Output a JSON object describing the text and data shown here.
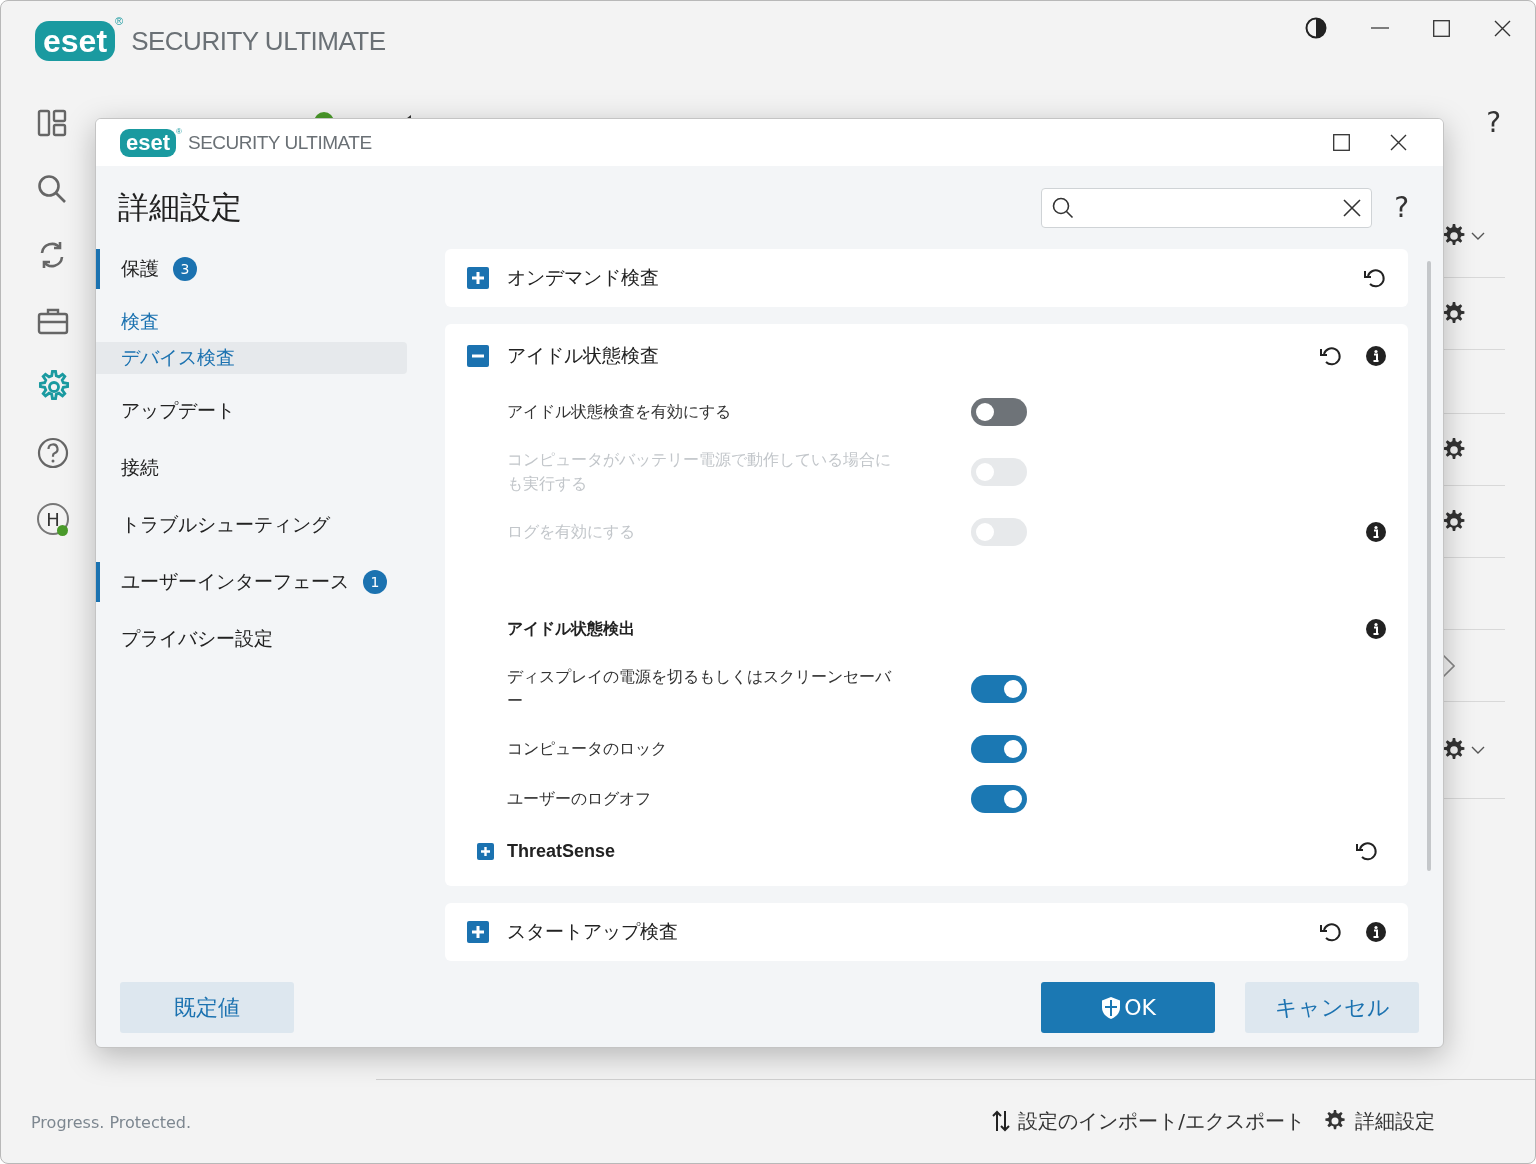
{
  "background_window": {
    "logo": {
      "brand": "eset",
      "mark": "®"
    },
    "product": "SECURITY ULTIMATE",
    "sidebar": [
      {
        "selected": false
      },
      {
        "selected": false
      },
      {
        "selected": false
      },
      {
        "selected": false
      },
      {
        "selected": true
      },
      {
        "selected": false
      },
      {
        "avatar_letter": "H",
        "selected": false
      }
    ],
    "help": "?",
    "footer": {
      "tagline": "Progress. Protected.",
      "links": [
        {
          "label": "設定のインポート/エクスポート"
        },
        {
          "label": "詳細設定"
        }
      ]
    }
  },
  "dialog": {
    "logo": {
      "brand": "eset",
      "mark": "®"
    },
    "product": "SECURITY ULTIMATE",
    "title": "詳細設定",
    "help": "?",
    "nav": [
      {
        "kind": "top",
        "label": "保護",
        "badge": "3",
        "marked": true,
        "selected": false
      },
      {
        "kind": "group",
        "label": "検査",
        "marked": false,
        "selected": false
      },
      {
        "kind": "sub",
        "label": "デバイス検査",
        "marked": false,
        "selected": true
      },
      {
        "kind": "top",
        "label": "アップデート",
        "marked": false,
        "selected": false
      },
      {
        "kind": "top",
        "label": "接続",
        "marked": false,
        "selected": false
      },
      {
        "kind": "top",
        "label": "トラブルシューティング",
        "marked": false,
        "selected": false
      },
      {
        "kind": "top",
        "label": "ユーザーインターフェース",
        "badge": "1",
        "marked": true,
        "selected": false
      },
      {
        "kind": "top",
        "label": "プライバシー設定",
        "marked": false,
        "selected": false
      }
    ],
    "sections": [
      {
        "title": "オンデマンド検査",
        "expanded": false,
        "info": false
      },
      {
        "title": "アイドル状態検査",
        "expanded": true,
        "info": true,
        "settings": [
          {
            "kind": "toggle",
            "label": "アイドル状態検査を有効にする",
            "on": false,
            "disabled": false,
            "info": false
          },
          {
            "kind": "toggle",
            "label": "コンピュータがバッテリー電源で動作している場合にも実行する",
            "on": false,
            "disabled": true,
            "info": false
          },
          {
            "kind": "toggle",
            "label": "ログを有効にする",
            "on": false,
            "disabled": true,
            "info": true
          },
          {
            "kind": "heading",
            "label": "アイドル状態検出",
            "info": true
          },
          {
            "kind": "toggle",
            "label": "ディスプレイの電源を切るもしくはスクリーンセーバー",
            "on": true,
            "disabled": false,
            "info": false
          },
          {
            "kind": "toggle",
            "label": "コンピュータのロック",
            "on": true,
            "disabled": false,
            "info": false
          },
          {
            "kind": "toggle",
            "label": "ユーザーのログオフ",
            "on": true,
            "disabled": false,
            "info": false
          },
          {
            "kind": "subsection",
            "label": "ThreatSense",
            "expanded": false
          }
        ]
      },
      {
        "title": "スタートアップ検査",
        "expanded": false,
        "info": true
      }
    ],
    "default_button": "既定値",
    "ok_button": "OK",
    "cancel_button": "キャンセル"
  }
}
